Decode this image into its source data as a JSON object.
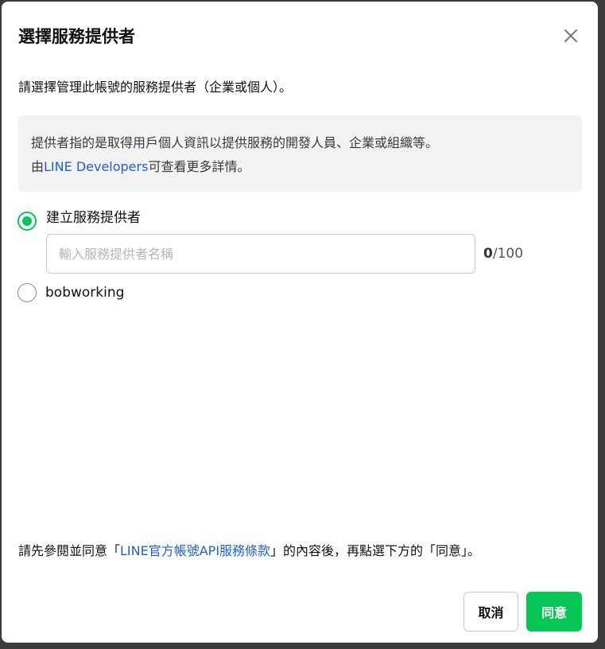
{
  "dialog": {
    "title": "選擇服務提供者",
    "intro": "請選擇管理此帳號的服務提供者（企業或個人）。",
    "info": {
      "line1": "提供者指的是取得用戶個人資訊以提供服務的開發人員、企業或組織等。",
      "line2_prefix": "由",
      "line2_link": "LINE Developers",
      "line2_suffix": "可查看更多詳情。"
    },
    "options": [
      {
        "label": "建立服務提供者",
        "selected": true
      },
      {
        "label": "bobworking",
        "selected": false
      }
    ],
    "provider_name_input": {
      "value": "",
      "placeholder": "輸入服務提供者名稱",
      "count": "0",
      "max": "/100"
    },
    "terms": {
      "prefix": "請先參閱並同意「",
      "link": "LINE官方帳號API服務條款",
      "suffix": "」的內容後，再點選下方的「同意」。"
    },
    "buttons": {
      "cancel": "取消",
      "agree": "同意"
    },
    "close_icon": "close-icon",
    "colors": {
      "accent": "#06c755",
      "link": "#1f5fd6",
      "info_bg": "#f2f2f2"
    }
  }
}
